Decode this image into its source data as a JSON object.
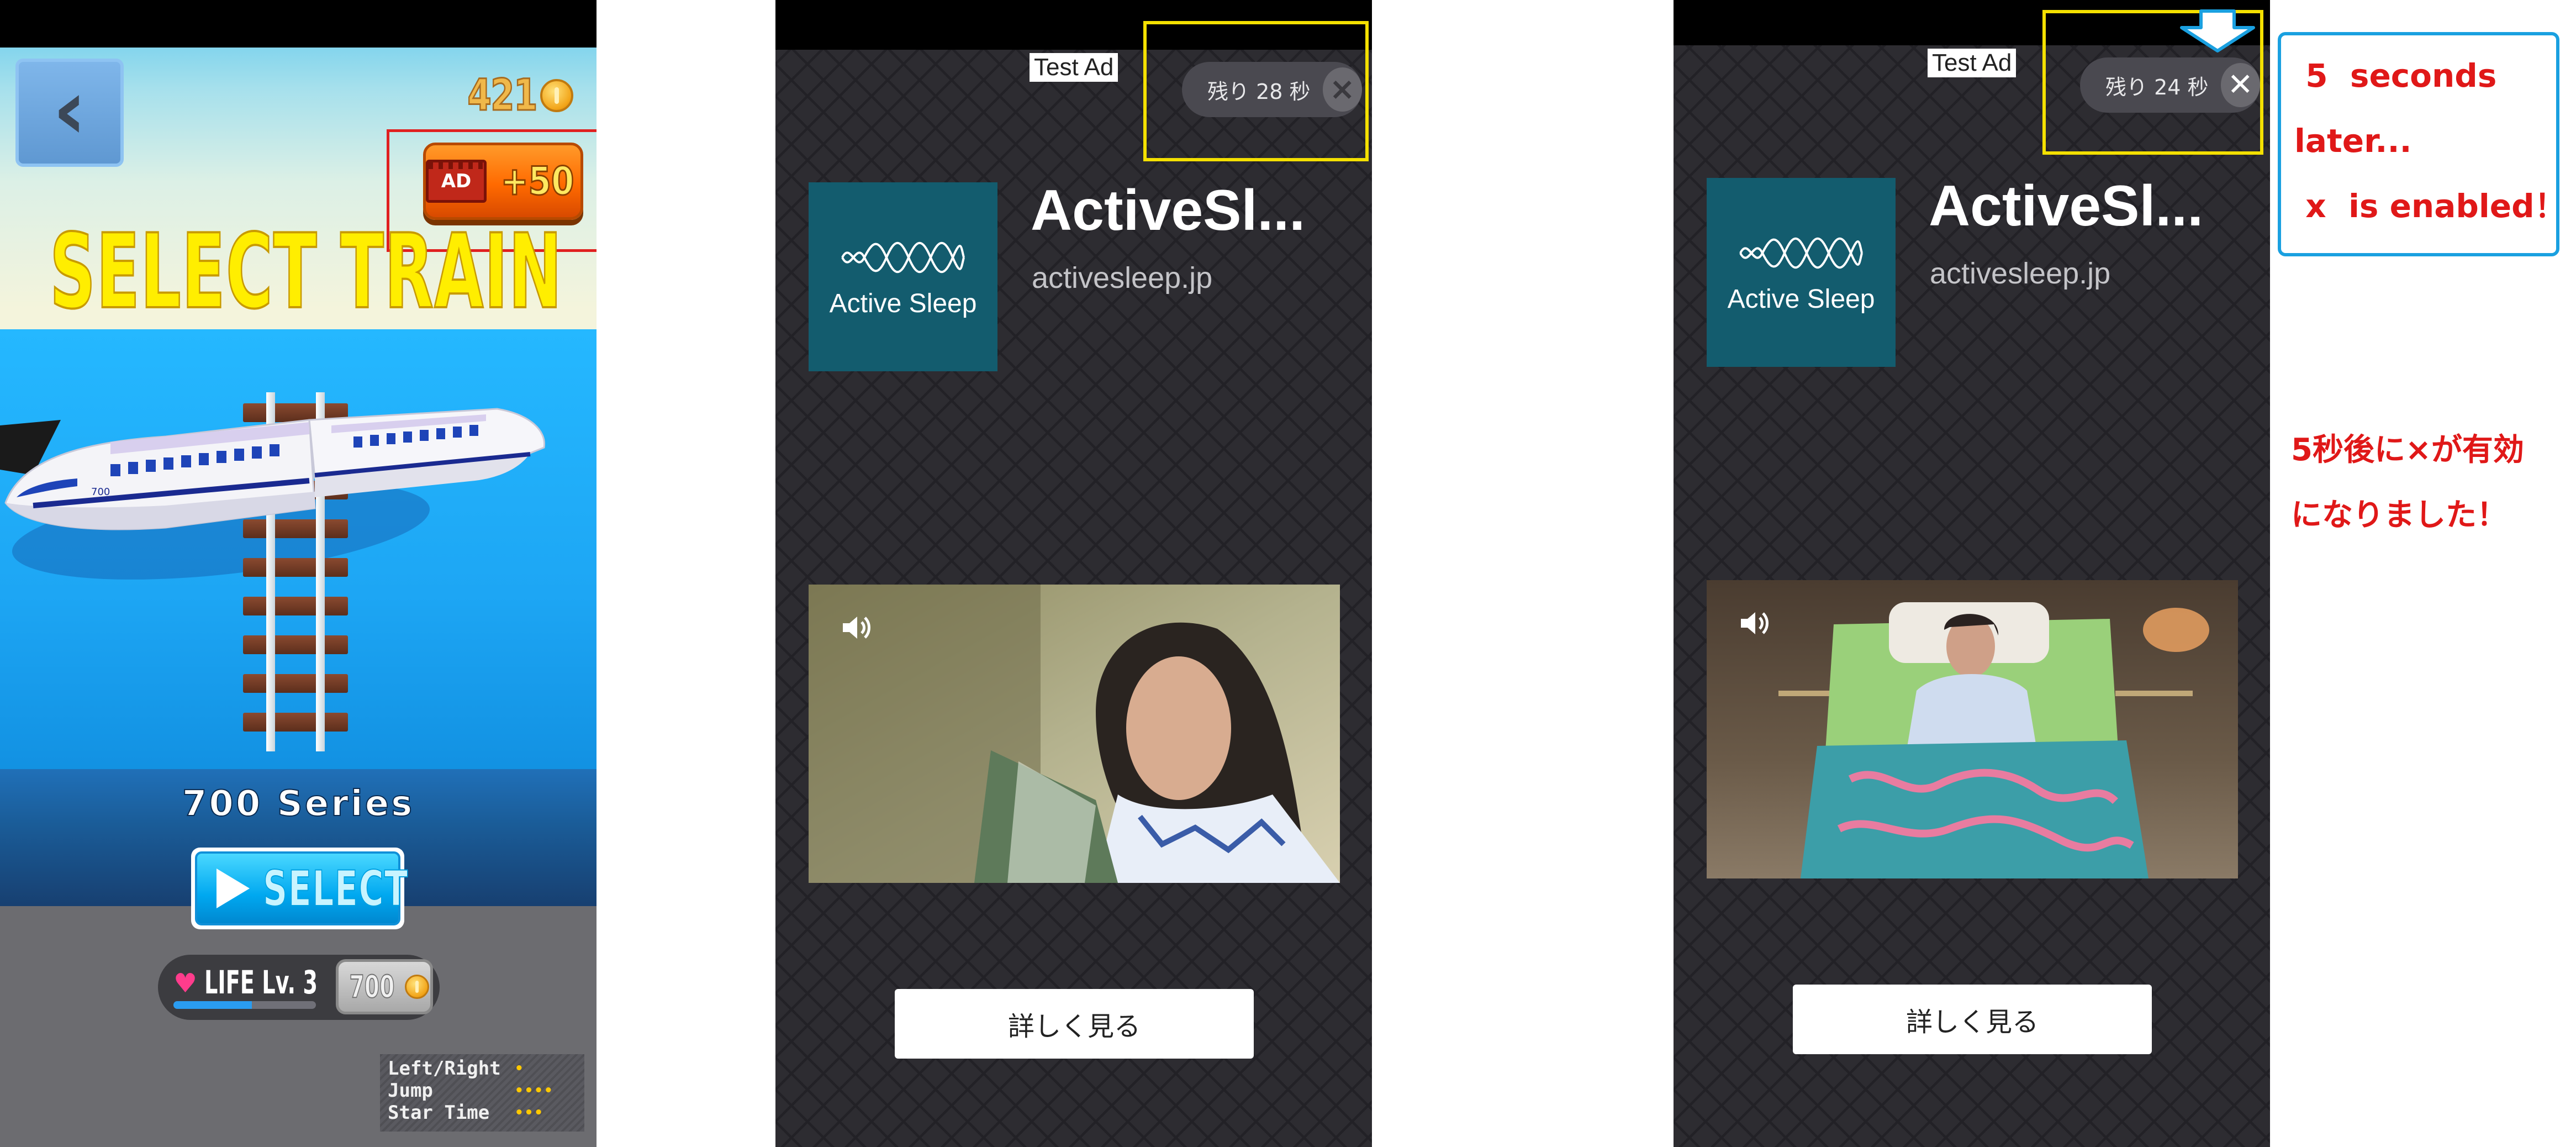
{
  "game": {
    "coins": "421",
    "ad_reward": "+50",
    "ad_badge": "AD",
    "title": "SELECT TRAIN",
    "train_name": "700 Series",
    "train_livery": "700",
    "select_label": "SELECT",
    "life_label": "LIFE  Lv. 3",
    "life_progress": 0.55,
    "upgrade_cost": "700",
    "help": [
      {
        "key": "Left/Right",
        "stars": "•"
      },
      {
        "key": "Jump",
        "stars": "••••"
      },
      {
        "key": "Star Time",
        "stars": "•••"
      }
    ],
    "colors": {
      "title": "#ffee00",
      "ad_button": "#ff7a10",
      "select_button": "#00a8f0",
      "highlight_box": "#e02020"
    }
  },
  "ad_before": {
    "test_label": "Test Ad",
    "timer_text": "残り 28 秒",
    "close_icon": "×",
    "close_enabled": false,
    "logo_text": "Active Sleep",
    "app_title": "ActiveSl...",
    "app_url": "activesleep.jp",
    "video_scene": "woman-reading-book",
    "cta_label": "詳しく見る"
  },
  "ad_after": {
    "test_label": "Test Ad",
    "timer_text": "残り 24 秒",
    "close_icon": "✕",
    "close_enabled": true,
    "logo_text": "Active Sleep",
    "app_title": "ActiveSl...",
    "app_url": "activesleep.jp",
    "video_scene": "woman-on-adjustable-bed",
    "cta_label": "詳しく見る"
  },
  "annotation": {
    "line1": " 5  seconds",
    "line2": "later...",
    "line3": " x  is enabled！",
    "jp_line1": "5秒後に×が有効",
    "jp_line2": "になりました！",
    "colors": {
      "text": "#e01818",
      "box": "#1aa0e0",
      "highlight": "#f4e000"
    }
  }
}
